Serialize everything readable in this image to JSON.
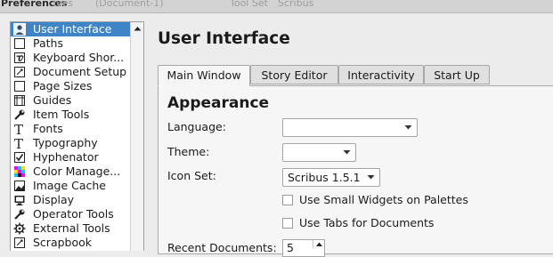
{
  "window": {
    "title": "Preferences",
    "background_texts": [
      "ives",
      "(Document-1)",
      "Tool Set",
      "Scribus"
    ]
  },
  "sidebar": {
    "items": [
      {
        "label": "User Interface",
        "icon": "user-icon",
        "selected": true
      },
      {
        "label": "Paths",
        "icon": "folder-icon"
      },
      {
        "label": "Keyboard Shor...",
        "icon": "keyboard-icon"
      },
      {
        "label": "Document Setup",
        "icon": "document-icon"
      },
      {
        "label": "Page Sizes",
        "icon": "page-icon"
      },
      {
        "label": "Guides",
        "icon": "guides-icon"
      },
      {
        "label": "Item Tools",
        "icon": "wrench-icon"
      },
      {
        "label": "Fonts",
        "icon": "font-icon"
      },
      {
        "label": "Typography",
        "icon": "typography-icon"
      },
      {
        "label": "Hyphenator",
        "icon": "checkmark-icon"
      },
      {
        "label": "Color Manage...",
        "icon": "color-icon"
      },
      {
        "label": "Image Cache",
        "icon": "image-icon"
      },
      {
        "label": "Display",
        "icon": "monitor-icon"
      },
      {
        "label": "Operator Tools",
        "icon": "wrench-icon"
      },
      {
        "label": "External Tools",
        "icon": "gear-icon"
      },
      {
        "label": "Scrapbook",
        "icon": "scrapbook-icon"
      }
    ]
  },
  "main": {
    "title": "User Interface",
    "tabs": [
      {
        "label": "Main Window",
        "active": true
      },
      {
        "label": "Story Editor"
      },
      {
        "label": "Interactivity"
      },
      {
        "label": "Start Up"
      }
    ],
    "section_title": "Appearance",
    "language": {
      "label": "Language:",
      "value": ""
    },
    "theme": {
      "label": "Theme:",
      "value": ""
    },
    "icon_set": {
      "label": "Icon Set:",
      "value": "Scribus 1.5.1"
    },
    "small_widgets": {
      "label": "Use Small Widgets on Palettes",
      "checked": false
    },
    "tabs_for_docs": {
      "label": "Use Tabs for Documents",
      "checked": false
    },
    "recent_documents": {
      "label": "Recent Documents:",
      "value": "5"
    }
  },
  "colors": {
    "selection": "#3d84c9",
    "panel": "#f6f6f6",
    "window": "#ececec"
  }
}
